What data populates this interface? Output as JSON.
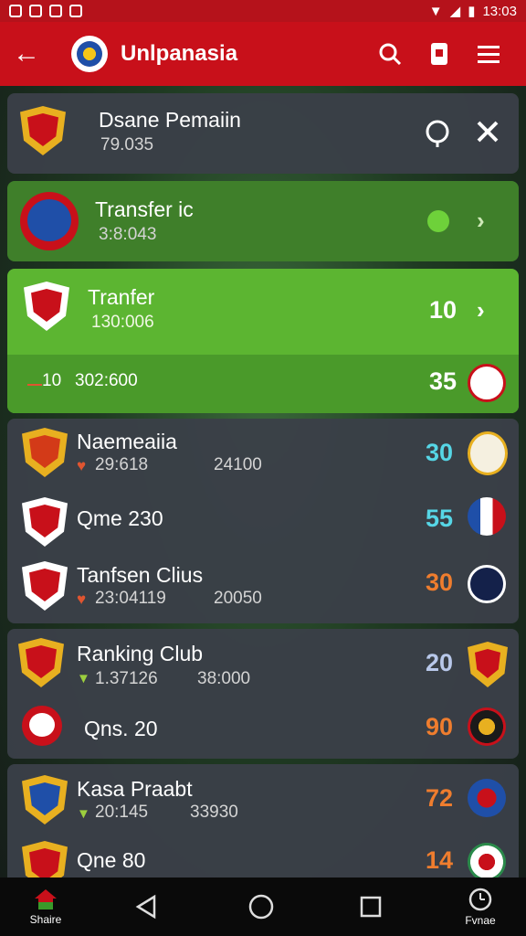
{
  "status_bar": {
    "time": "13:03"
  },
  "app_bar": {
    "title": "Unlpanasia"
  },
  "colors": {
    "app_red": "#c8101a",
    "card_dark": "#3a4048",
    "green_light": "#5cb531",
    "green_dark": "#3f7f2a",
    "cyan": "#56d6e6",
    "orange": "#ef7d2e",
    "blue_grey": "#b8c8ea"
  },
  "cards": {
    "c1": {
      "name": "Dsane Pemaiin",
      "sub": "79.035"
    },
    "c2": {
      "name": "Transfer  ic",
      "sub": "3:8:043"
    },
    "c3": {
      "name": "Tranfer",
      "sub": "130:006",
      "value": "10",
      "footer": "302:600",
      "footer_prefix": "10",
      "footer_value": "35"
    },
    "group1": [
      {
        "name": "Naemeaiia",
        "sub1": "29:618",
        "sub2": "24100",
        "value": "30"
      },
      {
        "name": "Qme 230",
        "value": "55"
      },
      {
        "name": "Tanfsen Clius",
        "sub1": "23:04119",
        "sub2": "20050",
        "value": "30"
      }
    ],
    "group2": [
      {
        "name": "Ranking Club",
        "sub1": "1.37126",
        "sub2": "38:000",
        "value": "20"
      },
      {
        "name": "Qns. 20",
        "value": "90"
      }
    ],
    "group3": [
      {
        "name": "Kasa Praabt",
        "sub1": "20:145",
        "sub2": "33930",
        "value": "72"
      },
      {
        "name": "Qne 80",
        "value": "14"
      }
    ]
  },
  "bottom_nav": {
    "left_label": "Shaire",
    "right_label": "Fvnae"
  }
}
